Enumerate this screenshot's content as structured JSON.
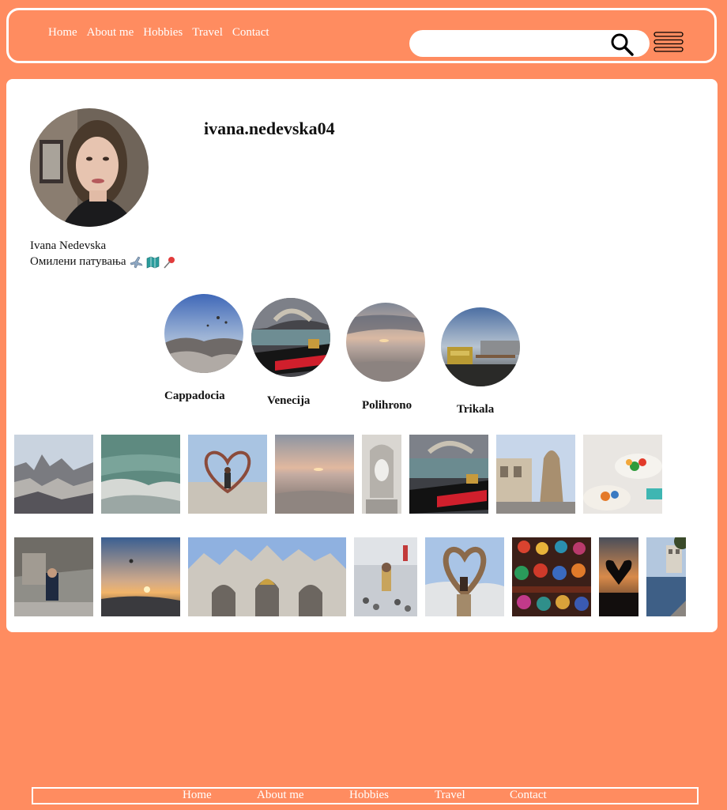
{
  "nav": {
    "items": [
      {
        "label": "Home"
      },
      {
        "label": "About me"
      },
      {
        "label": "Hobbies"
      },
      {
        "label": "Travel"
      },
      {
        "label": "Contact"
      }
    ]
  },
  "search": {
    "value": "",
    "placeholder": ""
  },
  "profile": {
    "username": "ivana.nedevska04",
    "name": "Ivana Nedevska",
    "bio": "Омилени патувања",
    "bio_emojis": [
      "airplane-icon",
      "map-icon",
      "pushpin-icon"
    ]
  },
  "highlights": [
    {
      "label": "Cappadocia"
    },
    {
      "label": "Venecija"
    },
    {
      "label": "Polihrono"
    },
    {
      "label": "Trikala"
    }
  ],
  "footer": {
    "items": [
      {
        "label": "Home"
      },
      {
        "label": "About me"
      },
      {
        "label": "Hobbies"
      },
      {
        "label": "Travel"
      },
      {
        "label": "Contact"
      }
    ]
  },
  "colors": {
    "background": "#ff8c60",
    "panel": "#ffffff",
    "nav_text": "#ffffff"
  }
}
